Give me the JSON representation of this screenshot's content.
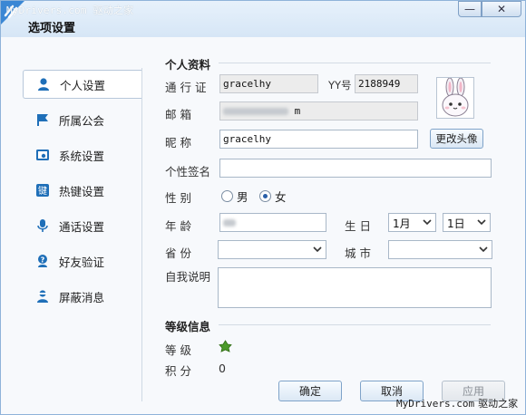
{
  "window": {
    "title": "选项设置",
    "watermark_top": "MyDrivers.com 驱动之家",
    "minimize_symbol": "—",
    "close_symbol": "✕"
  },
  "sidebar": {
    "items": [
      {
        "label": "个人设置",
        "icon": "person-icon",
        "active": true
      },
      {
        "label": "所属公会",
        "icon": "flag-icon",
        "active": false
      },
      {
        "label": "系统设置",
        "icon": "system-icon",
        "active": false
      },
      {
        "label": "热键设置",
        "icon": "hotkey-icon",
        "active": false
      },
      {
        "label": "通话设置",
        "icon": "microphone-icon",
        "active": false
      },
      {
        "label": "好友验证",
        "icon": "friend-verify-icon",
        "active": false
      },
      {
        "label": "屏蔽消息",
        "icon": "block-message-icon",
        "active": false
      }
    ]
  },
  "profile": {
    "section_title": "个人资料",
    "passport_label": "通 行 证",
    "passport_value": "gracelhy",
    "yy_label": "YY号",
    "yy_value": "2188949",
    "email_label": "邮     箱",
    "email_tail": "m",
    "nickname_label": "昵     称",
    "nickname_value": "gracelhy",
    "change_avatar_button": "更改头像",
    "signature_label": "个性签名",
    "signature_value": "",
    "gender_label": "性     别",
    "gender_male": "男",
    "gender_female": "女",
    "gender_selected": "女",
    "age_label": "年     龄",
    "birthday_label": "生  日",
    "birthday_month": "1月",
    "birthday_day": "1日",
    "province_label": "省     份",
    "province_value": "",
    "city_label": "城  市",
    "city_value": "",
    "bio_label": "自我说明",
    "bio_value": ""
  },
  "level": {
    "section_title": "等级信息",
    "level_label": "等     级",
    "level_icon": "green-leaf-level-icon",
    "points_label": "积     分",
    "points_value": "0"
  },
  "footer": {
    "ok_button": "确定",
    "cancel_button": "取消",
    "apply_button": "应用",
    "watermark": "MyDrivers.com",
    "watermark_cn": "驱动之家"
  },
  "colors": {
    "accent": "#2a5fa8",
    "sidebar_icon": "#1f6fb8",
    "border": "#a9b8c8"
  }
}
